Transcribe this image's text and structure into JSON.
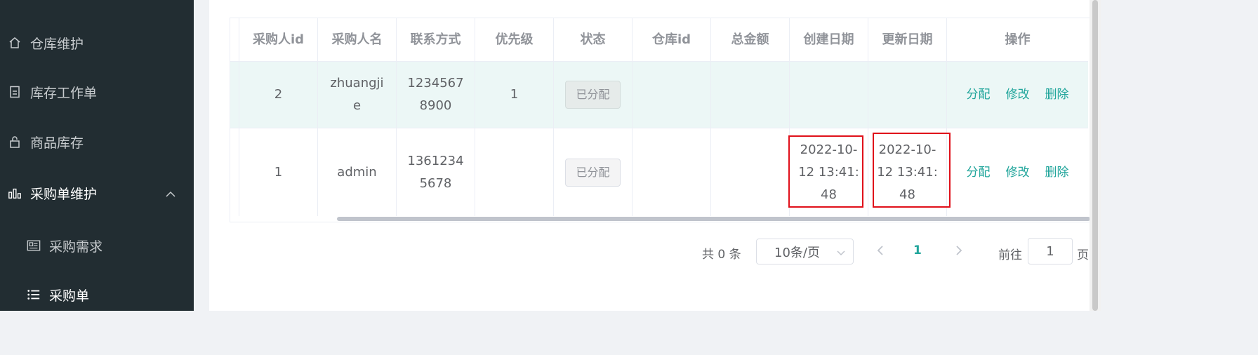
{
  "sidebar": {
    "items": [
      {
        "label": "仓库维护",
        "icon": "home-icon"
      },
      {
        "label": "库存工作单",
        "icon": "document-icon"
      },
      {
        "label": "商品库存",
        "icon": "lock-icon"
      },
      {
        "label": "采购单维护",
        "icon": "bar-chart-icon",
        "expanded": true
      },
      {
        "label": "采购需求",
        "icon": "news-icon"
      },
      {
        "label": "采购单",
        "icon": "list-icon"
      }
    ]
  },
  "table": {
    "headers": [
      "采购人id",
      "采购人名",
      "联系方式",
      "优先级",
      "状态",
      "仓库id",
      "总金额",
      "创建日期",
      "更新日期",
      "操作"
    ],
    "rows": [
      {
        "buyer_id": "2",
        "buyer_name_1": "zhuangji",
        "buyer_name_2": "e",
        "phone_1": "1234567",
        "phone_2": "8900",
        "priority": "1",
        "status": "已分配",
        "warehouse_id": "",
        "total": "",
        "created_1": "",
        "created_2": "",
        "created_3": "",
        "updated_1": "",
        "updated_2": "",
        "updated_3": ""
      },
      {
        "buyer_id": "1",
        "buyer_name_1": "admin",
        "buyer_name_2": "",
        "phone_1": "1361234",
        "phone_2": "5678",
        "priority": "",
        "status": "已分配",
        "warehouse_id": "",
        "total": "",
        "created_1": "2022-10-",
        "created_2": "12 13:41:",
        "created_3": "48",
        "updated_1": "2022-10-",
        "updated_2": "12 13:41:",
        "updated_3": "48"
      }
    ],
    "actions": {
      "assign": "分配",
      "edit": "修改",
      "delete": "删除"
    }
  },
  "pagination": {
    "total_text": "共 0 条",
    "page_size": "10条/页",
    "current_page": "1",
    "goto_label": "前往",
    "goto_value": "1",
    "page_label": "页"
  },
  "colors": {
    "sidebar_bg": "#222d32",
    "accent": "#20a59b",
    "highlight_box": "#e0101a",
    "row_hover": "#ecf7f6"
  }
}
